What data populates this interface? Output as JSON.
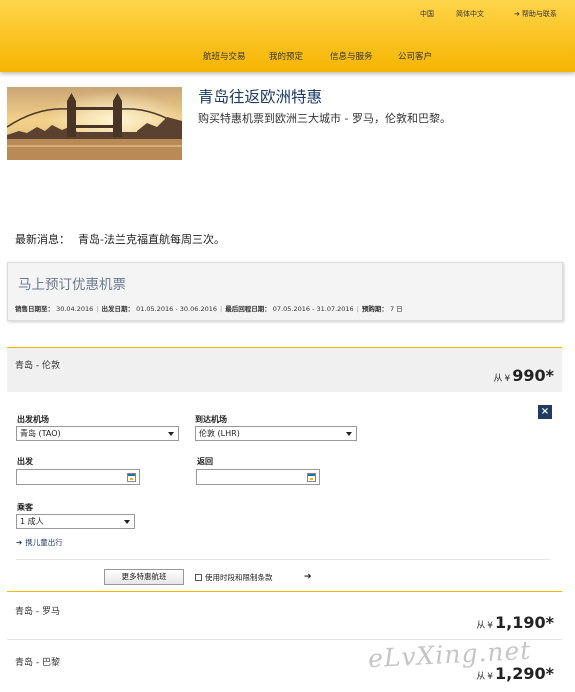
{
  "header": {
    "lang": "中国",
    "script": "简体中文",
    "help": "帮助与联系",
    "nav": [
      "航班与交易",
      "我的预定",
      "信息与服务",
      "公司客户"
    ]
  },
  "promo": {
    "title": "青岛往返欧洲特惠",
    "subtitle": "购买特惠机票到欧洲三大城市 - 罗马，伦敦和巴黎。"
  },
  "news": {
    "label": "最新消息：",
    "text": "青岛-法兰克福直航每周三次。"
  },
  "offer": {
    "title": "马上预订优惠机票",
    "meta": {
      "sale_label": "销售日期至：",
      "sale_value": "30.04.2016",
      "depart_label": "出发日期：",
      "depart_value": "01.05.2016 - 30.06.2016",
      "return_label": "最后回程日期：",
      "return_value": "07.05.2016 - 31.07.2016",
      "advance_label": "预购期：",
      "advance_value": "7 日"
    }
  },
  "routes": [
    {
      "name": "青岛 - 伦敦",
      "from": "从",
      "currency": "¥",
      "price": "990*"
    },
    {
      "name": "青岛 - 罗马",
      "from": "从",
      "currency": "¥",
      "price": "1,190*"
    },
    {
      "name": "青岛 - 巴黎",
      "from": "从",
      "currency": "¥",
      "price": "1,290*"
    }
  ],
  "form": {
    "close": "×",
    "origin_label": "出发机场",
    "origin_value": "青岛 (TAO)",
    "dest_label": "到达机场",
    "dest_value": "伦敦 (LHR)",
    "depart_label": "出发",
    "return_label": "返回",
    "pax_label": "乘客",
    "pax_value": "1 成人",
    "child_link": "携儿童出行",
    "more_button": "更多特惠航班",
    "terms": "使用时段和限制条款"
  },
  "watermark": "eLvXing.net"
}
